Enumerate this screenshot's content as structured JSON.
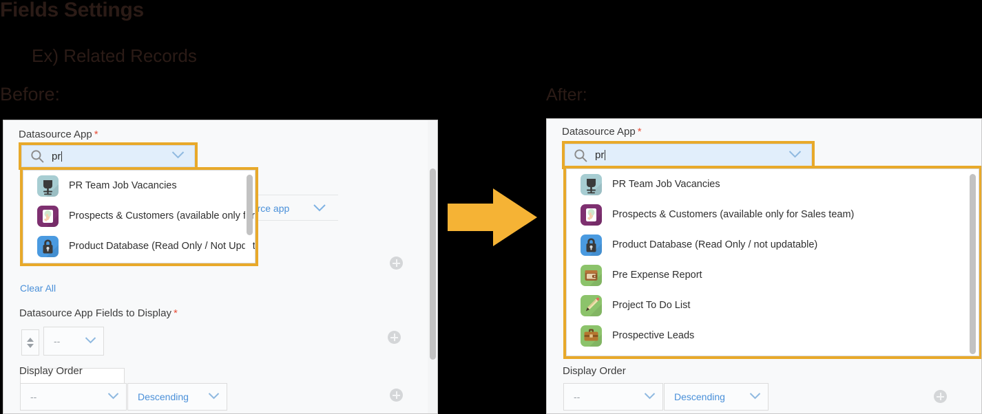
{
  "slide": {
    "title": "Fields Settings",
    "subtitle": "Ex) Related Records",
    "before_label": "Before:",
    "after_label": "After:",
    "arrow_color": "#f5b335",
    "highlight_color": "#e8a92a",
    "title_color": "#2b1b16"
  },
  "before": {
    "datasource_label": "Datasource App",
    "required_mark": "*",
    "search": {
      "value": "pr",
      "placeholder": ""
    },
    "options": [
      {
        "name": "PR Team Job Vacancies",
        "icon": "office-chair-icon"
      },
      {
        "name": "Prospects & Customers (available only for S…",
        "icon": "hand-card-icon"
      },
      {
        "name": "Product Database (Read Only / Not Updata…",
        "icon": "padlock-icon"
      }
    ],
    "behind_link": "ource app",
    "clear_all": "Clear All",
    "fields_to_display_label": "Datasource App Fields to Display",
    "fields_to_display_value": "--",
    "display_order_label": "Display Order",
    "display_order_value": "--",
    "display_order_direction": "Descending"
  },
  "after": {
    "datasource_label": "Datasource App",
    "required_mark": "*",
    "search": {
      "value": "pr",
      "placeholder": ""
    },
    "options": [
      {
        "name": "PR Team Job Vacancies",
        "icon": "office-chair-icon"
      },
      {
        "name": "Prospects & Customers (available only for Sales team)",
        "icon": "hand-card-icon"
      },
      {
        "name": "Product Database (Read Only / not updatable)",
        "icon": "padlock-icon"
      },
      {
        "name": "Pre Expense Report",
        "icon": "wallet-icon"
      },
      {
        "name": "Project To Do List",
        "icon": "pencil-icon"
      },
      {
        "name": "Prospective Leads",
        "icon": "briefcase-icon"
      }
    ],
    "display_order_label": "Display Order",
    "display_order_value": "--",
    "display_order_direction": "Descending"
  }
}
